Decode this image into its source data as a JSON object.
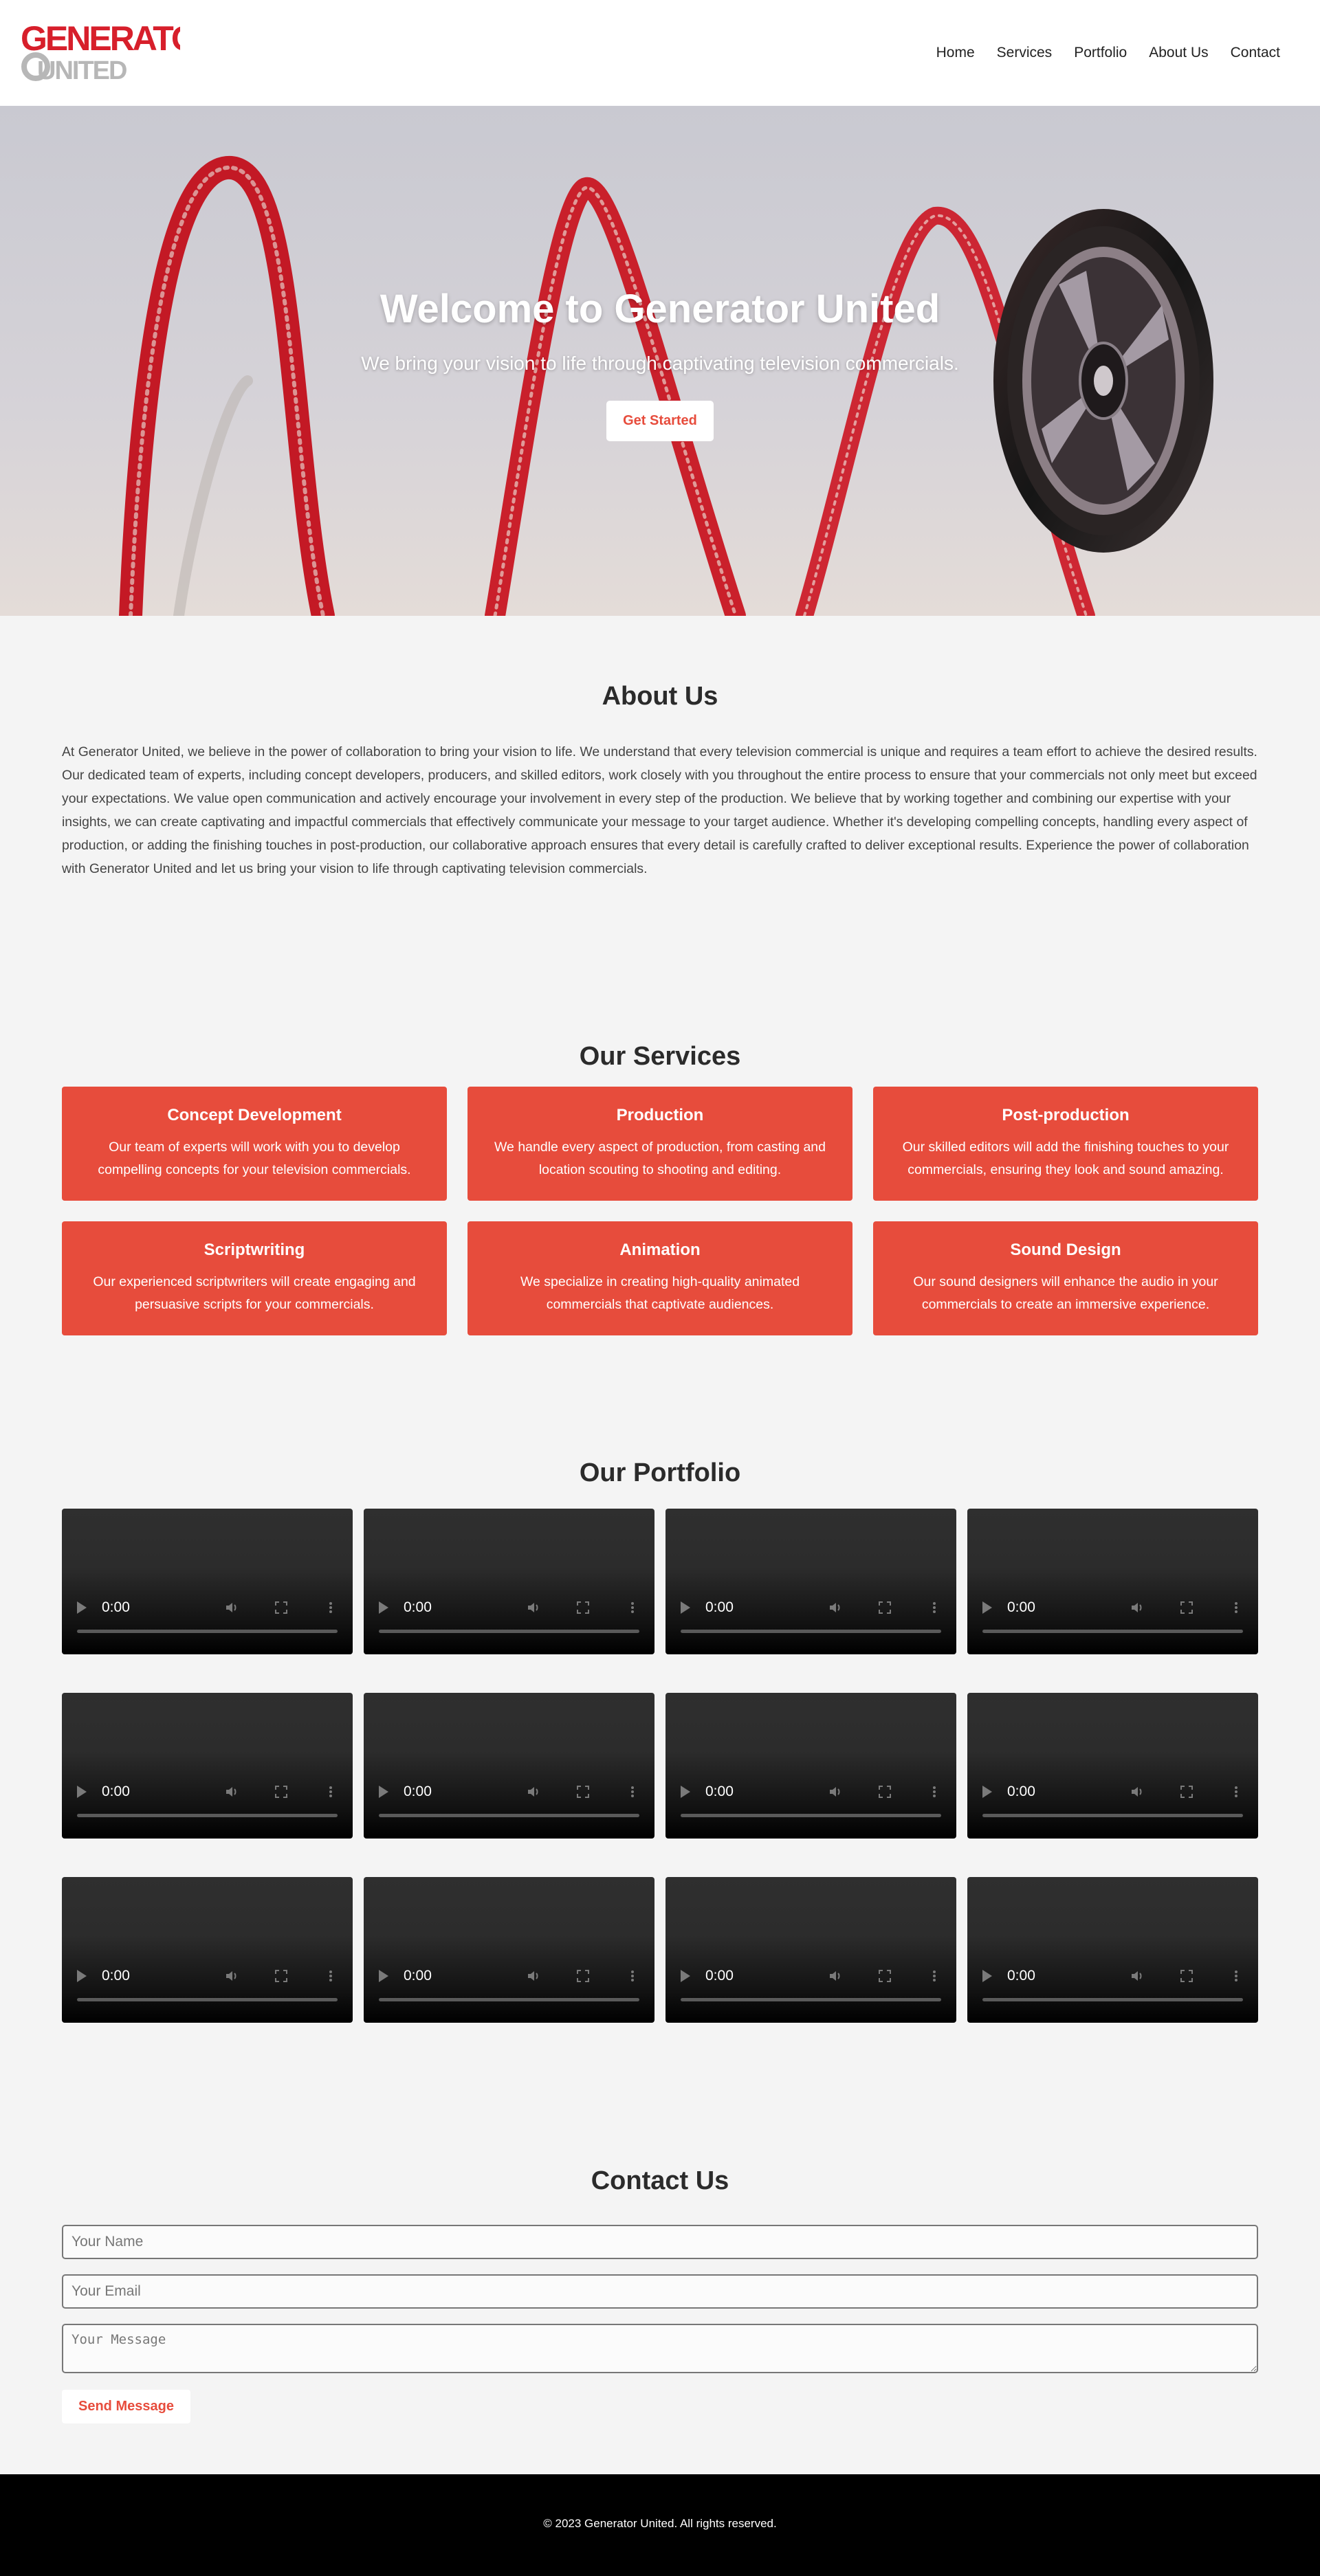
{
  "brand": {
    "logo_line1": "GENERATOR",
    "logo_line2": "UNITED",
    "accent": "#e74c3c",
    "logo_red": "#d71f2b"
  },
  "nav": {
    "items": [
      "Home",
      "Services",
      "Portfolio",
      "About Us",
      "Contact"
    ]
  },
  "hero": {
    "title": "Welcome to Generator United",
    "subtitle": "We bring your vision to life through captivating television commercials.",
    "cta_label": "Get Started"
  },
  "about": {
    "title": "About Us",
    "text": "At Generator United, we believe in the power of collaboration to bring your vision to life. We understand that every television commercial is unique and requires a team effort to achieve the desired results. Our dedicated team of experts, including concept developers, producers, and skilled editors, work closely with you throughout the entire process to ensure that your commercials not only meet but exceed your expectations. We value open communication and actively encourage your involvement in every step of the production. We believe that by working together and combining our expertise with your insights, we can create captivating and impactful commercials that effectively communicate your message to your target audience. Whether it's developing compelling concepts, handling every aspect of production, or adding the finishing touches in post-production, our collaborative approach ensures that every detail is carefully crafted to deliver exceptional results. Experience the power of collaboration with Generator United and let us bring your vision to life through captivating television commercials."
  },
  "services": {
    "title": "Our Services",
    "items": [
      {
        "title": "Concept Development",
        "text": "Our team of experts will work with you to develop compelling concepts for your television commercials."
      },
      {
        "title": "Production",
        "text": "We handle every aspect of production, from casting and location scouting to shooting and editing."
      },
      {
        "title": "Post-production",
        "text": "Our skilled editors will add the finishing touches to your commercials, ensuring they look and sound amazing."
      },
      {
        "title": "Scriptwriting",
        "text": "Our experienced scriptwriters will create engaging and persuasive scripts for your commercials."
      },
      {
        "title": "Animation",
        "text": "We specialize in creating high-quality animated commercials that captivate audiences."
      },
      {
        "title": "Sound Design",
        "text": "Our sound designers will enhance the audio in your commercials to create an immersive experience."
      }
    ]
  },
  "portfolio": {
    "title": "Our Portfolio",
    "video_time": "0:00",
    "video_count": 12,
    "icons": [
      "play-icon",
      "volume-icon",
      "fullscreen-icon",
      "more-options-icon"
    ]
  },
  "contact": {
    "title": "Contact Us",
    "name_placeholder": "Your Name",
    "email_placeholder": "Your Email",
    "message_placeholder": "Your Message",
    "send_label": "Send Message"
  },
  "footer": {
    "text": "© 2023 Generator United. All rights reserved."
  }
}
